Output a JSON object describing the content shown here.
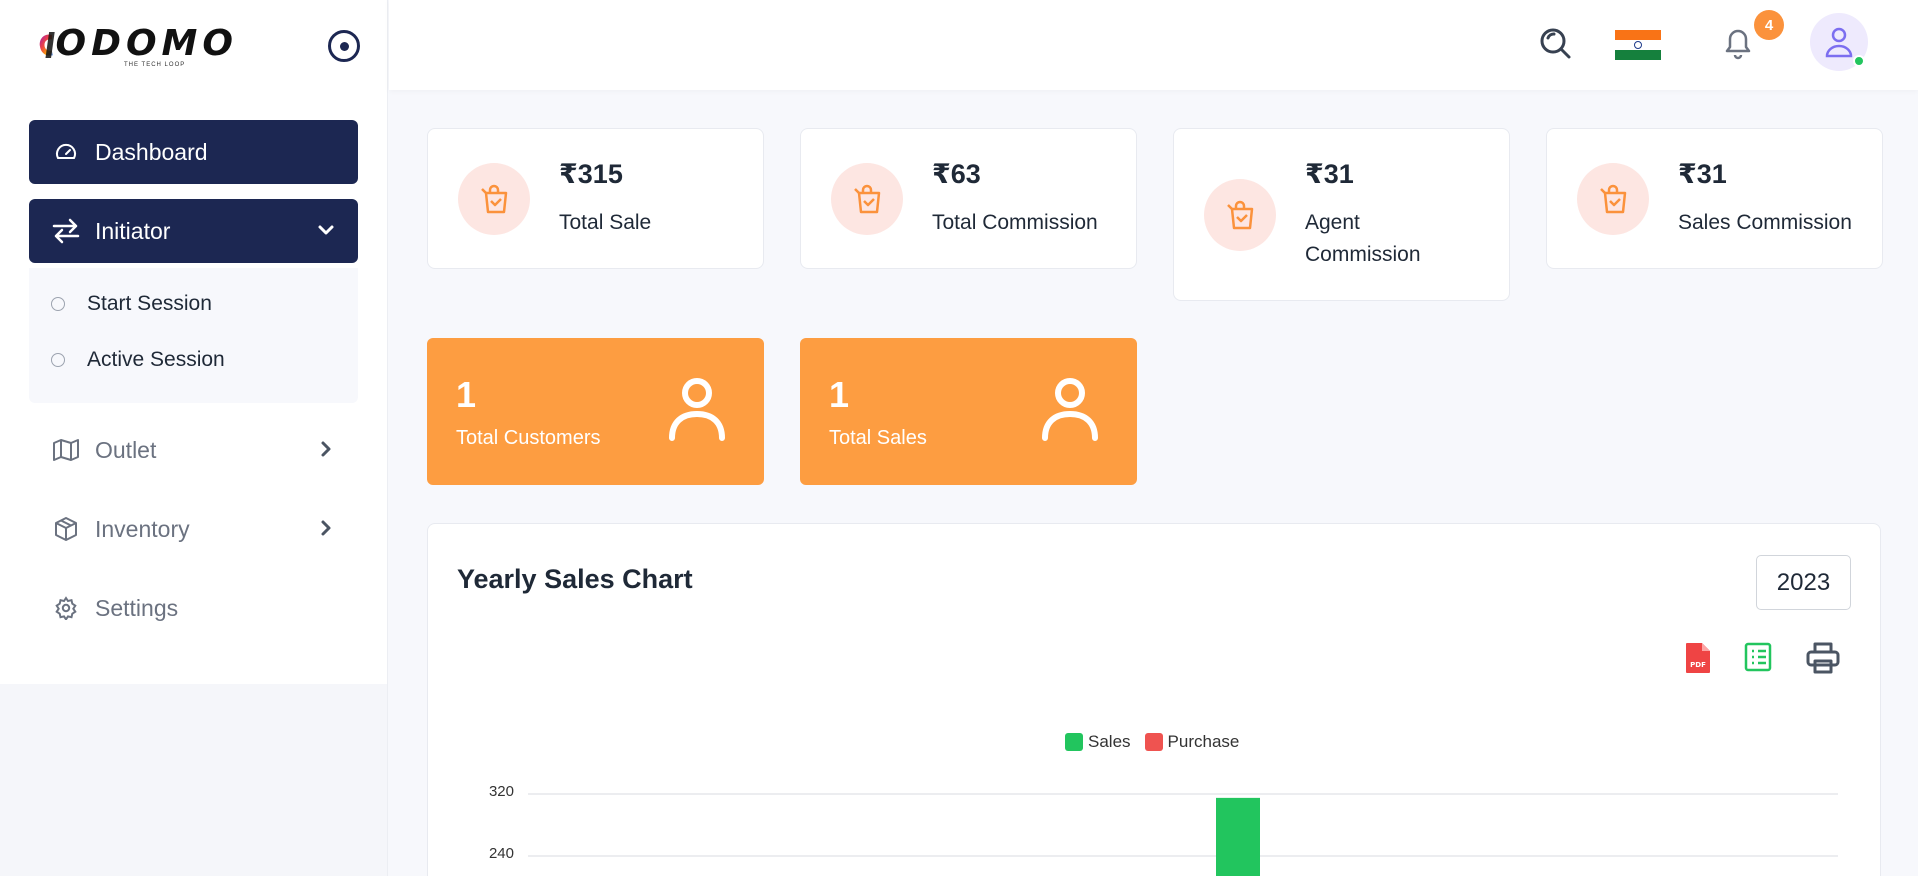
{
  "brand": {
    "name": "ODOMO",
    "tagline": "THE TECH LOOP"
  },
  "sidebar": {
    "items": [
      {
        "label": "Dashboard",
        "icon": "speedometer-icon",
        "active": true
      },
      {
        "label": "Initiator",
        "icon": "arrows-exchange-icon",
        "expanded": true,
        "children": [
          {
            "label": "Start Session"
          },
          {
            "label": "Active Session"
          }
        ]
      },
      {
        "label": "Outlet",
        "icon": "map-icon"
      },
      {
        "label": "Inventory",
        "icon": "box-icon"
      },
      {
        "label": "Settings",
        "icon": "gear-icon"
      }
    ]
  },
  "header": {
    "notification_count": "4",
    "language_flag": "india-flag"
  },
  "stats": [
    {
      "value": "₹315",
      "label": "Total Sale"
    },
    {
      "value": "₹63",
      "label": "Total Commission"
    },
    {
      "value": "₹31",
      "label_line1": "Agent",
      "label_line2": "Commission"
    },
    {
      "value": "₹31",
      "label": "Sales Commission"
    }
  ],
  "counters": [
    {
      "value": "1",
      "label": "Total Customers"
    },
    {
      "value": "1",
      "label": "Total Sales"
    }
  ],
  "chart_section": {
    "title": "Yearly Sales Chart",
    "year": "2023",
    "exports": [
      "pdf-icon",
      "spreadsheet-icon",
      "print-icon"
    ]
  },
  "colors": {
    "primary": "#1c2752",
    "accent_orange": "#fd9d41",
    "sales": "#22c55e",
    "purchase": "#ef5350"
  },
  "chart_data": {
    "type": "bar",
    "title": "Yearly Sales Chart",
    "legend_position": "top",
    "series": [
      {
        "name": "Sales",
        "values": [
          315
        ]
      },
      {
        "name": "Purchase",
        "values": [
          0
        ]
      }
    ],
    "categories": [
      ""
    ],
    "y_ticks": [
      320,
      240
    ],
    "ylim": [
      0,
      320
    ],
    "grid": true
  }
}
